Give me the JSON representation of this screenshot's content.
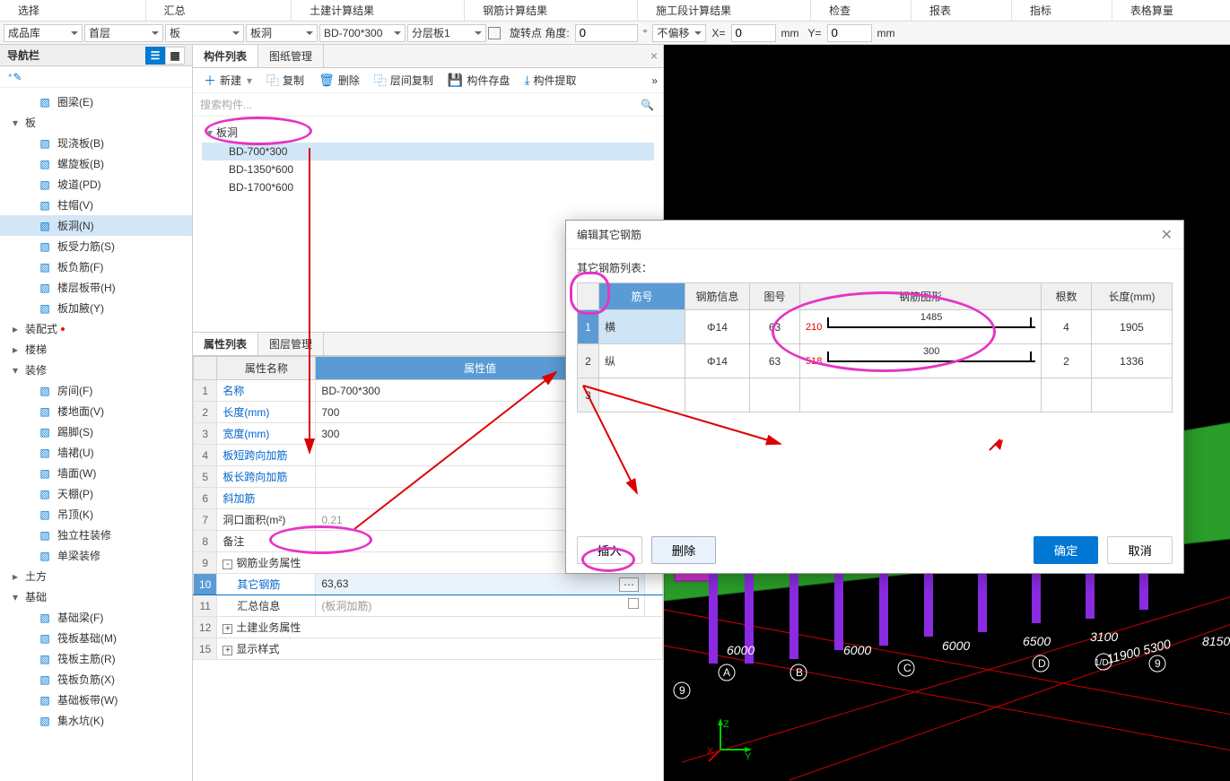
{
  "menu": [
    "选择",
    "汇总",
    "土建计算结果",
    "钢筋计算结果",
    "施工段计算结果",
    "检查",
    "报表",
    "指标",
    "表格算量"
  ],
  "toolbar": {
    "lib": "成品库",
    "floor": "首层",
    "cat": "板",
    "sub": "板洞",
    "item": "BD-700*300",
    "layer": "分层板1",
    "rot_chk": false,
    "rot_lbl": "旋转点 角度:",
    "rot_val": "0",
    "offset": "不偏移",
    "x_lbl": "X=",
    "x_val": "0",
    "x_unit": "mm",
    "y_lbl": "Y=",
    "y_val": "0",
    "y_unit": "mm"
  },
  "nav": {
    "title": "导航栏",
    "items": [
      {
        "lvl": 2,
        "icon": "ring",
        "label": "圈梁(E)"
      },
      {
        "lvl": 1,
        "caret": "▾",
        "label": "板"
      },
      {
        "lvl": 2,
        "icon": "slab",
        "label": "现浇板(B)"
      },
      {
        "lvl": 2,
        "icon": "spiral",
        "label": "螺旋板(B)"
      },
      {
        "lvl": 2,
        "icon": "ramp",
        "label": "坡道(PD)"
      },
      {
        "lvl": 2,
        "icon": "cap",
        "label": "柱帽(V)"
      },
      {
        "lvl": 2,
        "icon": "hole",
        "label": "板洞(N)",
        "sel": true
      },
      {
        "lvl": 2,
        "icon": "rebar",
        "label": "板受力筋(S)"
      },
      {
        "lvl": 2,
        "icon": "neg",
        "label": "板负筋(F)"
      },
      {
        "lvl": 2,
        "icon": "band",
        "label": "楼层板带(H)"
      },
      {
        "lvl": 2,
        "icon": "haunch",
        "label": "板加腋(Y)"
      },
      {
        "lvl": 1,
        "caret": "▸",
        "label": "装配式",
        "dot": true
      },
      {
        "lvl": 1,
        "caret": "▸",
        "label": "楼梯"
      },
      {
        "lvl": 1,
        "caret": "▾",
        "label": "装修"
      },
      {
        "lvl": 2,
        "icon": "room",
        "label": "房间(F)"
      },
      {
        "lvl": 2,
        "icon": "floor",
        "label": "楼地面(V)"
      },
      {
        "lvl": 2,
        "icon": "skirt",
        "label": "踢脚(S)"
      },
      {
        "lvl": 2,
        "icon": "wain",
        "label": "墙裙(U)"
      },
      {
        "lvl": 2,
        "icon": "wall",
        "label": "墙面(W)"
      },
      {
        "lvl": 2,
        "icon": "ceil",
        "label": "天棚(P)"
      },
      {
        "lvl": 2,
        "icon": "susp",
        "label": "吊顶(K)"
      },
      {
        "lvl": 2,
        "icon": "col",
        "label": "独立柱装修"
      },
      {
        "lvl": 2,
        "icon": "beam",
        "label": "单梁装修"
      },
      {
        "lvl": 1,
        "caret": "▸",
        "label": "土方"
      },
      {
        "lvl": 1,
        "caret": "▾",
        "label": "基础"
      },
      {
        "lvl": 2,
        "icon": "fbeam",
        "label": "基础梁(F)"
      },
      {
        "lvl": 2,
        "icon": "raft",
        "label": "筏板基础(M)"
      },
      {
        "lvl": 2,
        "icon": "rmain",
        "label": "筏板主筋(R)"
      },
      {
        "lvl": 2,
        "icon": "rneg",
        "label": "筏板负筋(X)"
      },
      {
        "lvl": 2,
        "icon": "fband",
        "label": "基础板带(W)"
      },
      {
        "lvl": 2,
        "icon": "sump",
        "label": "集水坑(K)"
      }
    ]
  },
  "comp": {
    "tabs": [
      "构件列表",
      "图纸管理"
    ],
    "toolbar": [
      {
        "ico": "＋",
        "label": "新建",
        "split": true
      },
      {
        "ico": "⿻",
        "label": "复制"
      },
      {
        "ico": "🗑",
        "label": "删除"
      },
      {
        "ico": "⿻",
        "label": "层间复制"
      },
      {
        "ico": "💾",
        "label": "构件存盘"
      },
      {
        "ico": "⤓",
        "label": "构件提取"
      }
    ],
    "search_ph": "搜索构件...",
    "tree": [
      {
        "lvl": 0,
        "caret": "▾",
        "label": "板洞"
      },
      {
        "lvl": 1,
        "label": "BD-700*300",
        "sel": true
      },
      {
        "lvl": 1,
        "label": "BD-1350*600"
      },
      {
        "lvl": 1,
        "label": "BD-1700*600"
      }
    ]
  },
  "prop": {
    "tabs": [
      "属性列表",
      "图层管理"
    ],
    "headers": [
      "",
      "属性名称",
      "属性值",
      ""
    ],
    "rows": [
      {
        "n": "1",
        "name": "名称",
        "link": true,
        "val": "BD-700*300"
      },
      {
        "n": "2",
        "name": "长度(mm)",
        "link": true,
        "val": "700"
      },
      {
        "n": "3",
        "name": "宽度(mm)",
        "link": true,
        "val": "300"
      },
      {
        "n": "4",
        "name": "板短跨向加筋",
        "link": true,
        "val": ""
      },
      {
        "n": "5",
        "name": "板长跨向加筋",
        "link": true,
        "val": ""
      },
      {
        "n": "6",
        "name": "斜加筋",
        "link": true,
        "val": ""
      },
      {
        "n": "7",
        "name": "洞口面积(m²)",
        "val": "0.21",
        "grey": true
      },
      {
        "n": "8",
        "name": "备注",
        "val": ""
      },
      {
        "n": "9",
        "name": "钢筋业务属性",
        "group": true,
        "exp": "-"
      },
      {
        "n": "10",
        "name": "其它钢筋",
        "link": true,
        "indent": true,
        "val": "63,63",
        "sel": true,
        "dots": true
      },
      {
        "n": "11",
        "name": "汇总信息",
        "indent": true,
        "val": "(板洞加筋)",
        "grey": true,
        "box": true
      },
      {
        "n": "12",
        "name": "土建业务属性",
        "group": true,
        "exp": "+"
      },
      {
        "n": "15",
        "name": "显示样式",
        "group": true,
        "exp": "+"
      }
    ]
  },
  "dialog": {
    "title": "编辑其它钢筋",
    "list_label": "其它钢筋列表：",
    "headers": [
      "",
      "筋号",
      "钢筋信息",
      "图号",
      "钢筋图形",
      "根数",
      "长度(mm)"
    ],
    "rows": [
      {
        "n": "1",
        "name": "横",
        "info": "Φ14",
        "fig": "63",
        "shape_left": "210",
        "shape_len": "1485",
        "count": "4",
        "len": "1905",
        "sel": true
      },
      {
        "n": "2",
        "name": "纵",
        "info": "Φ14",
        "fig": "63",
        "shape_left": "518",
        "shape_len": "300",
        "count": "2",
        "len": "1336"
      },
      {
        "n": "3"
      }
    ],
    "btn_insert": "插入",
    "btn_delete": "删除",
    "btn_ok": "确定",
    "btn_cancel": "取消"
  },
  "viewport": {
    "grid_labels": [
      "6000",
      "6000",
      "6000",
      "6500",
      "3100",
      "11900",
      "5300",
      "8150"
    ],
    "axis_labels": [
      "A",
      "B",
      "C",
      "D",
      "1/D",
      "9",
      "9"
    ],
    "gizmo": {
      "x": "X",
      "y": "Y",
      "z": "Z"
    }
  }
}
